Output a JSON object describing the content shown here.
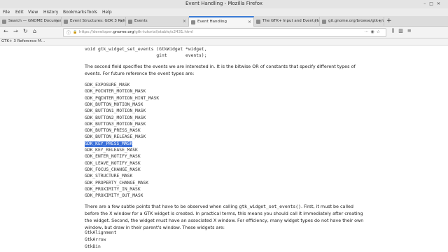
{
  "window": {
    "title": "Event Handling - Mozilla Firefox"
  },
  "menubar": {
    "items": [
      "File",
      "Edit",
      "View",
      "History",
      "Bookmarks",
      "Tools",
      "Help"
    ]
  },
  "tabs": [
    {
      "label": "Search — GNOME Documenta"
    },
    {
      "label": "Event Structures: GDK 3 Refe"
    },
    {
      "label": "Events"
    },
    {
      "label": "Event Handling"
    },
    {
      "label": "The GTK+ Input and Event Ha"
    },
    {
      "label": "git.gnome.org/browse/gtk+/c"
    }
  ],
  "active_tab": 3,
  "navbar": {
    "url_prefix": "https://developer.",
    "url_host": "gnome.org",
    "url_path": "/gtk-tutorial/stable/x2431.html"
  },
  "bookmarks": {
    "item": "GTK+ 3 Reference M..."
  },
  "content": {
    "code_sig_1": "void gtk_widget_set_events (GtkWidget *widget,",
    "code_sig_2": "                           gint       events);",
    "para1": "The second field specifies the events we are interested in. It is the bitwise OR of constants that specify different types of events. For future reference the event types are:",
    "masks": [
      "GDK_EXPOSURE_MASK",
      "GDK_POINTER_MOTION_MASK",
      "GDK_POINTER_MOTION_HINT_MASK",
      "GDK_BUTTON_MOTION_MASK",
      "GDK_BUTTON1_MOTION_MASK",
      "GDK_BUTTON2_MOTION_MASK",
      "GDK_BUTTON3_MOTION_MASK",
      "GDK_BUTTON_PRESS_MASK",
      "GDK_BUTTON_RELEASE_MASK",
      "GDK_KEY_PRESS_MASK",
      "GDK_KEY_RELEASE_MASK",
      "GDK_ENTER_NOTIFY_MASK",
      "GDK_LEAVE_NOTIFY_MASK",
      "GDK_FOCUS_CHANGE_MASK",
      "GDK_STRUCTURE_MASK",
      "GDK_PROPERTY_CHANGE_MASK",
      "GDK_PROXIMITY_IN_MASK",
      "GDK_PROXIMITY_OUT_MASK"
    ],
    "selected_mask": "GDK_KEY_PRESS_MASK",
    "para2_a": "There are a few subtle points that have to be observed when calling ",
    "para2_code": "gtk_widget_set_events()",
    "para2_b": ". First, it must be called before the X window for a GTK widget is created. In practical terms, this means you should call it immediately after creating the widget. Second, the widget must have an associated X window. For efficiency, many widget types do not have their own window, but draw in their parent's window. These widgets are:",
    "widgets": [
      "GtkAlignment",
      "GtkArrow",
      "GtkBin"
    ]
  }
}
